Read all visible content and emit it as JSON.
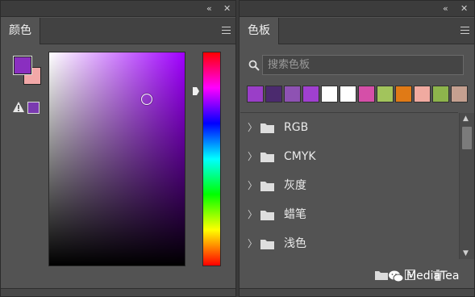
{
  "color_panel": {
    "strip_collapse": "«",
    "strip_close": "✕",
    "tab_label": "颜色",
    "foreground_color": "#8a2fc0",
    "background_color": "#f2a8a8",
    "gamut_color": "#7a3ab0",
    "picker_hue_color": "#a000ff",
    "picker_selection": {
      "saturation": 0.72,
      "brightness": 0.78
    },
    "hue_value": 0.185
  },
  "swatches_panel": {
    "strip_collapse": "«",
    "strip_close": "✕",
    "tab_label": "色板",
    "search_placeholder": "搜索色板",
    "swatches": [
      "#9a3ec8",
      "#4b2a6e",
      "#8e52b3",
      "#a040d0",
      "#ffffff",
      "#ffffff",
      "#d54fa8",
      "#a2c45c",
      "#e07a16",
      "#f0aaa0",
      "#8db44c",
      "#c5a090"
    ],
    "groups": [
      {
        "chevron": "〉",
        "label": "RGB"
      },
      {
        "chevron": "〉",
        "label": "CMYK"
      },
      {
        "chevron": "〉",
        "label": "灰度"
      },
      {
        "chevron": "〉",
        "label": "蜡笔"
      },
      {
        "chevron": "〉",
        "label": "浅色"
      }
    ],
    "scroll_up": "▲",
    "scroll_down": "▼",
    "watermark": "MediaTea"
  }
}
